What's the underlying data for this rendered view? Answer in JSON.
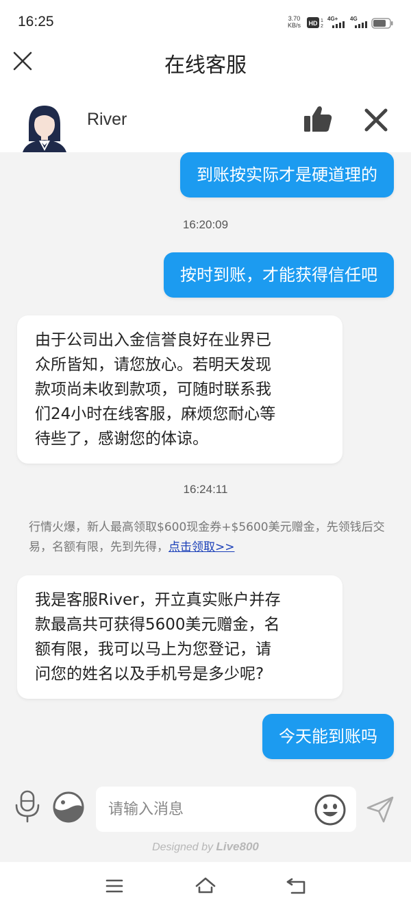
{
  "status_bar": {
    "time": "16:25",
    "net_speed_value": "3.70",
    "net_speed_unit": "KB/s",
    "hd_label": "HD",
    "sig1_label": "4G+",
    "sig2_label": "4G"
  },
  "header": {
    "title": "在线客服"
  },
  "agent": {
    "name": "River"
  },
  "messages": [
    {
      "role": "user",
      "text": "到账按实际才是硬道理的"
    },
    {
      "role": "time",
      "text": "16:20:09"
    },
    {
      "role": "user",
      "text": "按时到账，才能获得信任吧"
    },
    {
      "role": "agent",
      "lines": [
        "由于公司出入金信誉良好在业界已",
        "众所皆知，请您放心。若明天发现",
        "款项尚未收到款项，可随时联系我",
        "们24小时在线客服，麻烦您耐心等",
        "待些了，感谢您的体谅。"
      ]
    },
    {
      "role": "time",
      "text": "16:24:11"
    },
    {
      "role": "promo",
      "text": "行情火爆，新人最高领取$600现金券+$5600美元赠金，先领钱后交易，名额有限，先到先得，",
      "link": "点击领取>>"
    },
    {
      "role": "agent",
      "lines": [
        "我是客服River，开立真实账户并存",
        "款最高共可获得5600美元赠金，名",
        "额有限，我可以马上为您登记，请",
        "问您的姓名以及手机号是多少呢?"
      ]
    },
    {
      "role": "user",
      "text": "今天能到账吗"
    }
  ],
  "input": {
    "placeholder": "请输入消息",
    "value": ""
  },
  "footer": {
    "designed_by": "Designed by",
    "brand": "Live800"
  },
  "colors": {
    "user_bubble": "#1c9bf0",
    "chat_background": "#f3f3f3",
    "agent_bubble": "#ffffff",
    "link": "#1a3fb8"
  },
  "icons": {
    "close": "close-icon",
    "avatar": "agent-avatar",
    "like": "thumbs-up-icon",
    "end_chat": "x-icon",
    "mic": "microphone-icon",
    "emoji_panel": "yin-yang-icon",
    "smiley": "smiley-icon",
    "send": "send-icon",
    "menu": "menu-icon",
    "home": "home-icon",
    "back": "back-icon"
  }
}
